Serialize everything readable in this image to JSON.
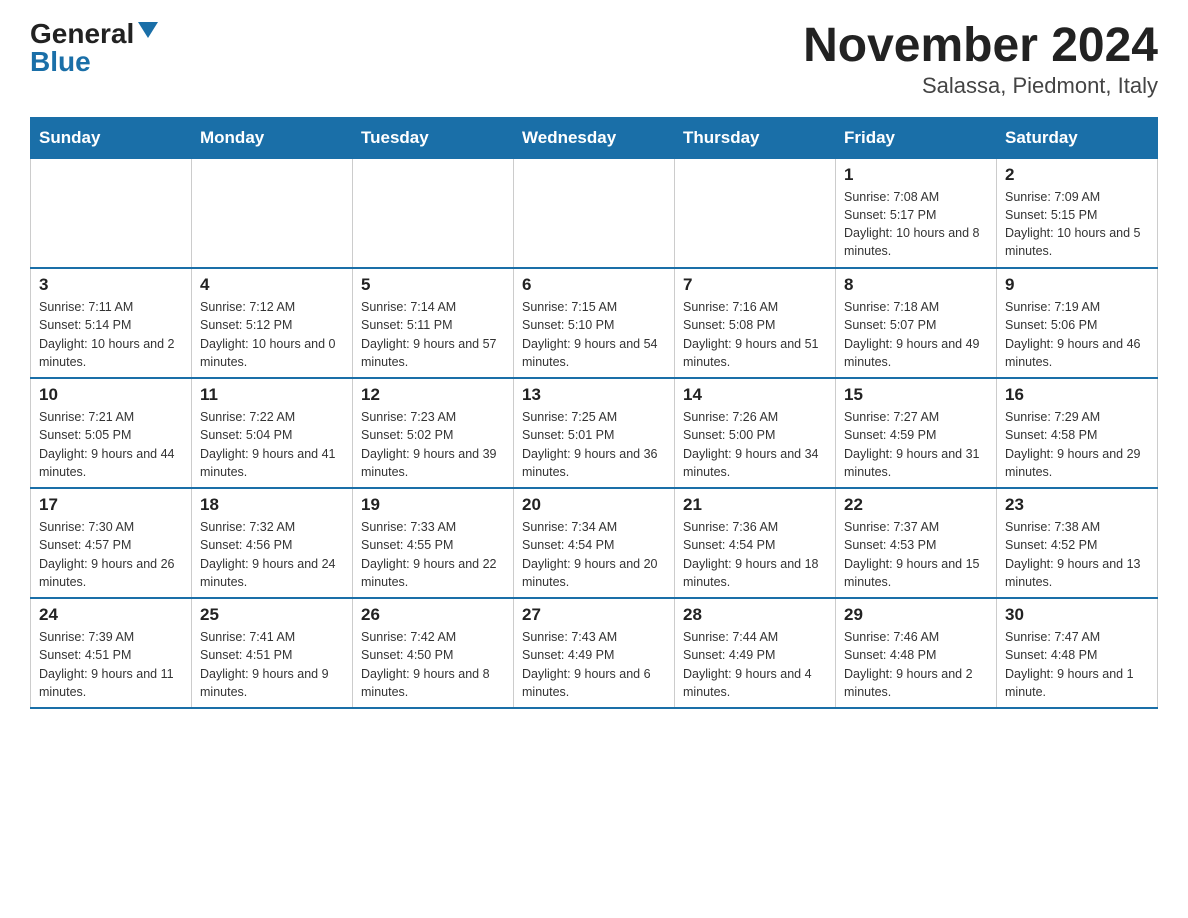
{
  "header": {
    "logo_general": "General",
    "logo_blue": "Blue",
    "title": "November 2024",
    "subtitle": "Salassa, Piedmont, Italy"
  },
  "weekdays": [
    "Sunday",
    "Monday",
    "Tuesday",
    "Wednesday",
    "Thursday",
    "Friday",
    "Saturday"
  ],
  "weeks": [
    [
      {
        "day": "",
        "info": ""
      },
      {
        "day": "",
        "info": ""
      },
      {
        "day": "",
        "info": ""
      },
      {
        "day": "",
        "info": ""
      },
      {
        "day": "",
        "info": ""
      },
      {
        "day": "1",
        "info": "Sunrise: 7:08 AM\nSunset: 5:17 PM\nDaylight: 10 hours and 8 minutes."
      },
      {
        "day": "2",
        "info": "Sunrise: 7:09 AM\nSunset: 5:15 PM\nDaylight: 10 hours and 5 minutes."
      }
    ],
    [
      {
        "day": "3",
        "info": "Sunrise: 7:11 AM\nSunset: 5:14 PM\nDaylight: 10 hours and 2 minutes."
      },
      {
        "day": "4",
        "info": "Sunrise: 7:12 AM\nSunset: 5:12 PM\nDaylight: 10 hours and 0 minutes."
      },
      {
        "day": "5",
        "info": "Sunrise: 7:14 AM\nSunset: 5:11 PM\nDaylight: 9 hours and 57 minutes."
      },
      {
        "day": "6",
        "info": "Sunrise: 7:15 AM\nSunset: 5:10 PM\nDaylight: 9 hours and 54 minutes."
      },
      {
        "day": "7",
        "info": "Sunrise: 7:16 AM\nSunset: 5:08 PM\nDaylight: 9 hours and 51 minutes."
      },
      {
        "day": "8",
        "info": "Sunrise: 7:18 AM\nSunset: 5:07 PM\nDaylight: 9 hours and 49 minutes."
      },
      {
        "day": "9",
        "info": "Sunrise: 7:19 AM\nSunset: 5:06 PM\nDaylight: 9 hours and 46 minutes."
      }
    ],
    [
      {
        "day": "10",
        "info": "Sunrise: 7:21 AM\nSunset: 5:05 PM\nDaylight: 9 hours and 44 minutes."
      },
      {
        "day": "11",
        "info": "Sunrise: 7:22 AM\nSunset: 5:04 PM\nDaylight: 9 hours and 41 minutes."
      },
      {
        "day": "12",
        "info": "Sunrise: 7:23 AM\nSunset: 5:02 PM\nDaylight: 9 hours and 39 minutes."
      },
      {
        "day": "13",
        "info": "Sunrise: 7:25 AM\nSunset: 5:01 PM\nDaylight: 9 hours and 36 minutes."
      },
      {
        "day": "14",
        "info": "Sunrise: 7:26 AM\nSunset: 5:00 PM\nDaylight: 9 hours and 34 minutes."
      },
      {
        "day": "15",
        "info": "Sunrise: 7:27 AM\nSunset: 4:59 PM\nDaylight: 9 hours and 31 minutes."
      },
      {
        "day": "16",
        "info": "Sunrise: 7:29 AM\nSunset: 4:58 PM\nDaylight: 9 hours and 29 minutes."
      }
    ],
    [
      {
        "day": "17",
        "info": "Sunrise: 7:30 AM\nSunset: 4:57 PM\nDaylight: 9 hours and 26 minutes."
      },
      {
        "day": "18",
        "info": "Sunrise: 7:32 AM\nSunset: 4:56 PM\nDaylight: 9 hours and 24 minutes."
      },
      {
        "day": "19",
        "info": "Sunrise: 7:33 AM\nSunset: 4:55 PM\nDaylight: 9 hours and 22 minutes."
      },
      {
        "day": "20",
        "info": "Sunrise: 7:34 AM\nSunset: 4:54 PM\nDaylight: 9 hours and 20 minutes."
      },
      {
        "day": "21",
        "info": "Sunrise: 7:36 AM\nSunset: 4:54 PM\nDaylight: 9 hours and 18 minutes."
      },
      {
        "day": "22",
        "info": "Sunrise: 7:37 AM\nSunset: 4:53 PM\nDaylight: 9 hours and 15 minutes."
      },
      {
        "day": "23",
        "info": "Sunrise: 7:38 AM\nSunset: 4:52 PM\nDaylight: 9 hours and 13 minutes."
      }
    ],
    [
      {
        "day": "24",
        "info": "Sunrise: 7:39 AM\nSunset: 4:51 PM\nDaylight: 9 hours and 11 minutes."
      },
      {
        "day": "25",
        "info": "Sunrise: 7:41 AM\nSunset: 4:51 PM\nDaylight: 9 hours and 9 minutes."
      },
      {
        "day": "26",
        "info": "Sunrise: 7:42 AM\nSunset: 4:50 PM\nDaylight: 9 hours and 8 minutes."
      },
      {
        "day": "27",
        "info": "Sunrise: 7:43 AM\nSunset: 4:49 PM\nDaylight: 9 hours and 6 minutes."
      },
      {
        "day": "28",
        "info": "Sunrise: 7:44 AM\nSunset: 4:49 PM\nDaylight: 9 hours and 4 minutes."
      },
      {
        "day": "29",
        "info": "Sunrise: 7:46 AM\nSunset: 4:48 PM\nDaylight: 9 hours and 2 minutes."
      },
      {
        "day": "30",
        "info": "Sunrise: 7:47 AM\nSunset: 4:48 PM\nDaylight: 9 hours and 1 minute."
      }
    ]
  ]
}
